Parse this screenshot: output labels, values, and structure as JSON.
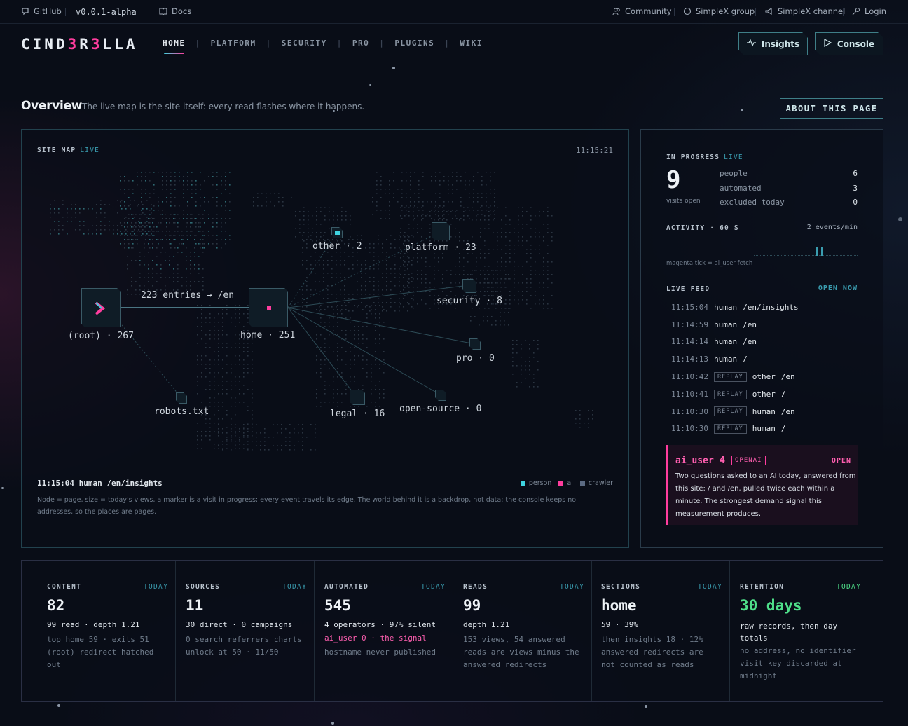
{
  "topbar": {
    "github": "GitHub",
    "version": "v0.0.1-alpha",
    "docs": "Docs",
    "community": "Community",
    "simplex_group": "SimpleX group",
    "simplex_channel": "SimpleX channel",
    "login": "Login"
  },
  "nav": {
    "logo_a": "CIND",
    "logo_b": "3",
    "logo_c": "R",
    "logo_d": "3",
    "logo_e": "LLA",
    "links": [
      "HOME",
      "PLATFORM",
      "SECURITY",
      "PRO",
      "PLUGINS",
      "WIKI"
    ],
    "insights": "Insights",
    "console": "Console"
  },
  "overview": {
    "title": "Overview",
    "subtitle": "The live map is the site itself: every read flashes where it happens.",
    "about": "ABOUT THIS PAGE"
  },
  "sitemap": {
    "label": "SITE MAP",
    "live": "LIVE",
    "time": "11:15:21",
    "edge_label": "223 entries → /en",
    "nodes": {
      "root": "(root) · 267",
      "home": "home · 251",
      "other": "other · 2",
      "platform": "platform · 23",
      "security": "security · 8",
      "pro": "pro · 0",
      "legal": "legal · 16",
      "open_source": "open-source · 0",
      "robots": "robots.txt"
    },
    "last_event": "11:15:04 human /en/insights",
    "legend": {
      "person": "person",
      "ai": "ai",
      "crawler": "crawler"
    },
    "legend_colors": {
      "person": "#3fd3e0",
      "ai": "#ff3d9e",
      "crawler": "#5b6a82"
    },
    "note": "Node = page, size = today's views, a marker is a visit in progress; every event travels its edge. The world behind it is a backdrop, not data: the console keeps no addresses, so the places are pages."
  },
  "progress": {
    "label": "IN PROGRESS",
    "live": "LIVE",
    "count": "9",
    "count_label": "visits open",
    "rows": [
      {
        "k": "people",
        "v": "6"
      },
      {
        "k": "automated",
        "v": "3"
      },
      {
        "k": "excluded today",
        "v": "0"
      }
    ]
  },
  "activity": {
    "label": "ACTIVITY · 60 S",
    "rate": "2 events/min",
    "note": "magenta tick = ai_user fetch"
  },
  "feed": {
    "label": "LIVE FEED",
    "open_now": "OPEN NOW",
    "replay": "REPLAY",
    "items": [
      {
        "t": "11:15:04",
        "who": "human",
        "path": "/en/insights",
        "replay": false
      },
      {
        "t": "11:14:59",
        "who": "human",
        "path": "/en",
        "replay": false
      },
      {
        "t": "11:14:14",
        "who": "human",
        "path": "/en",
        "replay": false
      },
      {
        "t": "11:14:13",
        "who": "human",
        "path": "/",
        "replay": false
      },
      {
        "t": "11:10:42",
        "who": "other",
        "path": "/en",
        "replay": true
      },
      {
        "t": "11:10:41",
        "who": "other",
        "path": "/",
        "replay": true
      },
      {
        "t": "11:10:30",
        "who": "human",
        "path": "/en",
        "replay": true
      },
      {
        "t": "11:10:30",
        "who": "human",
        "path": "/",
        "replay": true
      }
    ]
  },
  "ai_card": {
    "name": "ai_user",
    "num": "4",
    "tag": "OPENAI",
    "status": "OPEN",
    "text": "Two questions asked to an AI today, answered from this site: / and /en, pulled twice each within a minute. The strongest demand signal this measurement produces."
  },
  "stats": [
    {
      "head": "CONTENT",
      "today": "TODAY",
      "big": "82",
      "l1": "99 read · depth 1.21",
      "l2": "top home 59 · exits 51 (root) redirect hatched out"
    },
    {
      "head": "SOURCES",
      "today": "TODAY",
      "big": "11",
      "l1": "30 direct · 0 campaigns",
      "l2": "0 search referrers charts unlock at 50 · 11/50"
    },
    {
      "head": "AUTOMATED",
      "today": "TODAY",
      "big": "545",
      "l1": "4 operators · 97% silent",
      "l1b": "ai_user 0 · the signal",
      "l2": "hostname never published"
    },
    {
      "head": "READS",
      "today": "TODAY",
      "big": "99",
      "l1": "depth 1.21",
      "l2": "153 views, 54 answered reads are views minus the answered redirects"
    },
    {
      "head": "SECTIONS",
      "today": "TODAY",
      "big": "home",
      "l1": "59 · 39%",
      "l2": "then insights 18 · 12% answered redirects are not counted as reads"
    },
    {
      "head": "RETENTION",
      "today": "TODAY",
      "big": "30 days",
      "l1": "raw records, then day totals",
      "l2": "no address, no identifier visit key discarded at midnight"
    }
  ]
}
